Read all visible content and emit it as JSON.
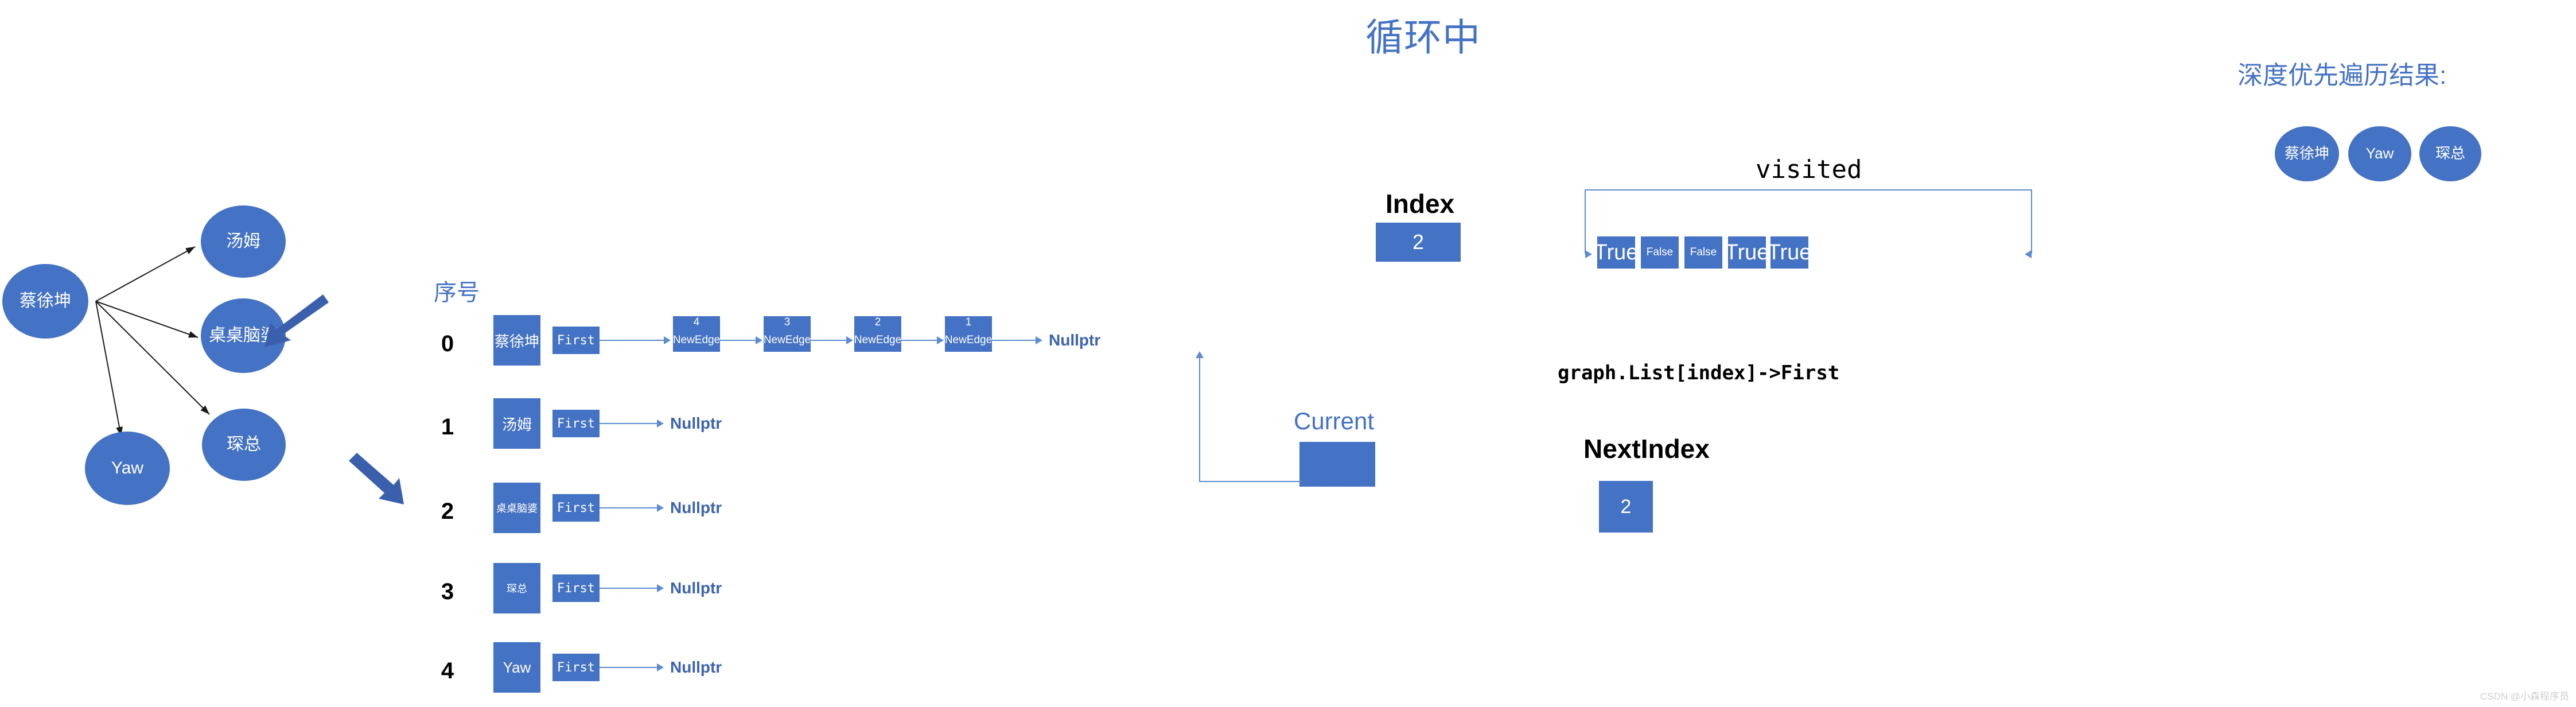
{
  "page": {
    "title": "循环中",
    "watermark": "CSDN @小森程序员"
  },
  "graph": {
    "nodes": [
      {
        "id": "caixukun",
        "label": "蔡徐坤"
      },
      {
        "id": "tangmu",
        "label": "汤姆"
      },
      {
        "id": "zhuozhuo",
        "label": "桌桌脑婆"
      },
      {
        "id": "chenzong",
        "label": "琛总"
      },
      {
        "id": "yaw",
        "label": "Yaw"
      }
    ]
  },
  "adjacency": {
    "header_label": "序号",
    "first_label": "First",
    "nullptr_label": "Nullptr",
    "edge_label": "NewEdge",
    "rows": [
      {
        "index": "0",
        "name": "蔡徐坤",
        "edges": [
          "4",
          "3",
          "2",
          "1"
        ],
        "terminator": "Nullptr"
      },
      {
        "index": "1",
        "name": "汤姆",
        "edges": [],
        "terminator": "Nullptr"
      },
      {
        "index": "2",
        "name": "桌桌脑婆",
        "edges": [],
        "terminator": "Nullptr"
      },
      {
        "index": "3",
        "name": "琛总",
        "edges": [],
        "terminator": "Nullptr"
      },
      {
        "index": "4",
        "name": "Yaw",
        "edges": [],
        "terminator": "Nullptr"
      }
    ]
  },
  "index_panel": {
    "title": "Index",
    "value": "2"
  },
  "next_index_panel": {
    "title": "NextIndex",
    "value": "2"
  },
  "current_panel": {
    "title": "Current",
    "value": ""
  },
  "visited_panel": {
    "title": "visited",
    "expression": "graph.List[index]->First",
    "cells": [
      "True",
      "False",
      "False",
      "True",
      "True"
    ]
  },
  "dfs_result": {
    "title": "深度优先遍历结果:",
    "items": [
      "蔡徐坤",
      "Yaw",
      "琛总"
    ]
  },
  "colors": {
    "accent": "#4472C4",
    "connector": "#5B8BD0",
    "text_blue": "#3C63AE"
  }
}
